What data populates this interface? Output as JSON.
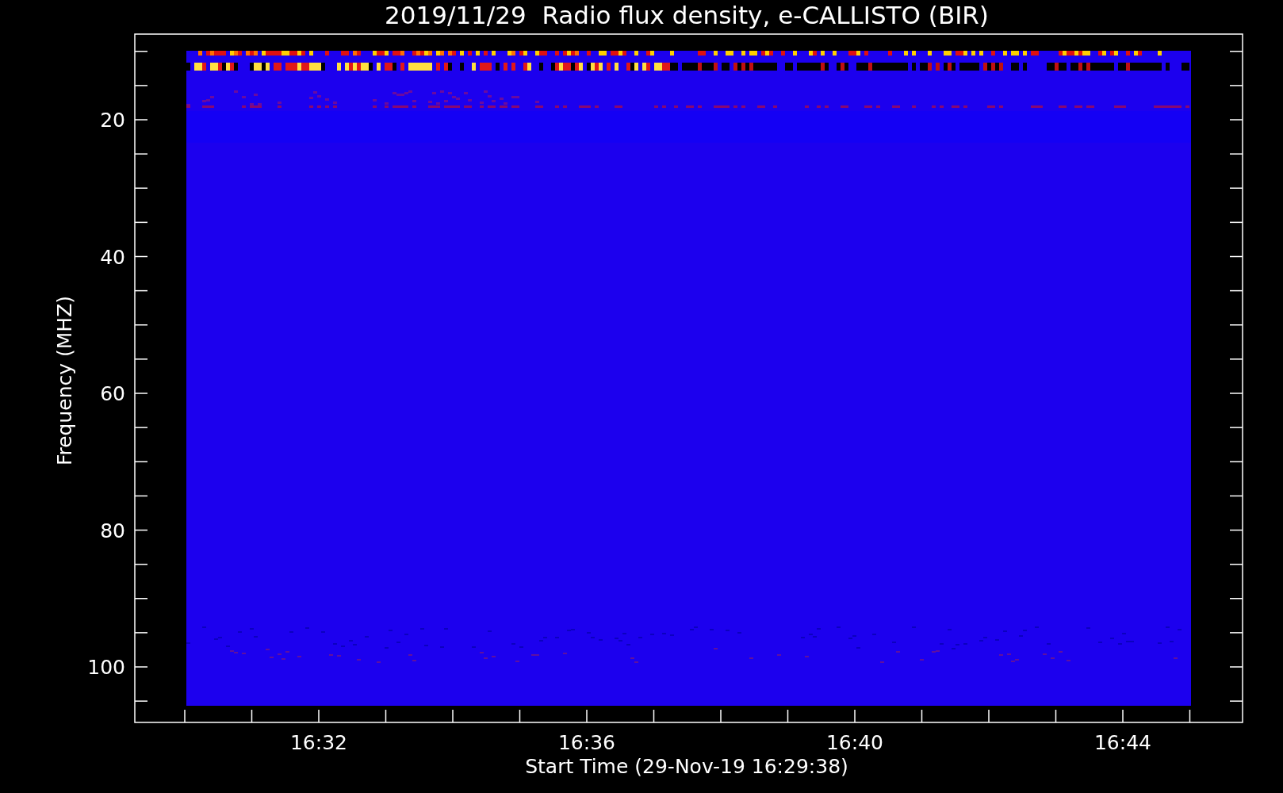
{
  "title": "2019/11/29  Radio flux density, e-CALLISTO (BIR)",
  "y_axis": {
    "label": "Frequency (MHZ)",
    "ticks": [
      "20",
      "40",
      "60",
      "80",
      "100"
    ]
  },
  "x_axis": {
    "label": "Start Time (29-Nov-19 16:29:38)",
    "ticks": [
      "16:32",
      "16:36",
      "16:40",
      "16:44"
    ]
  }
}
